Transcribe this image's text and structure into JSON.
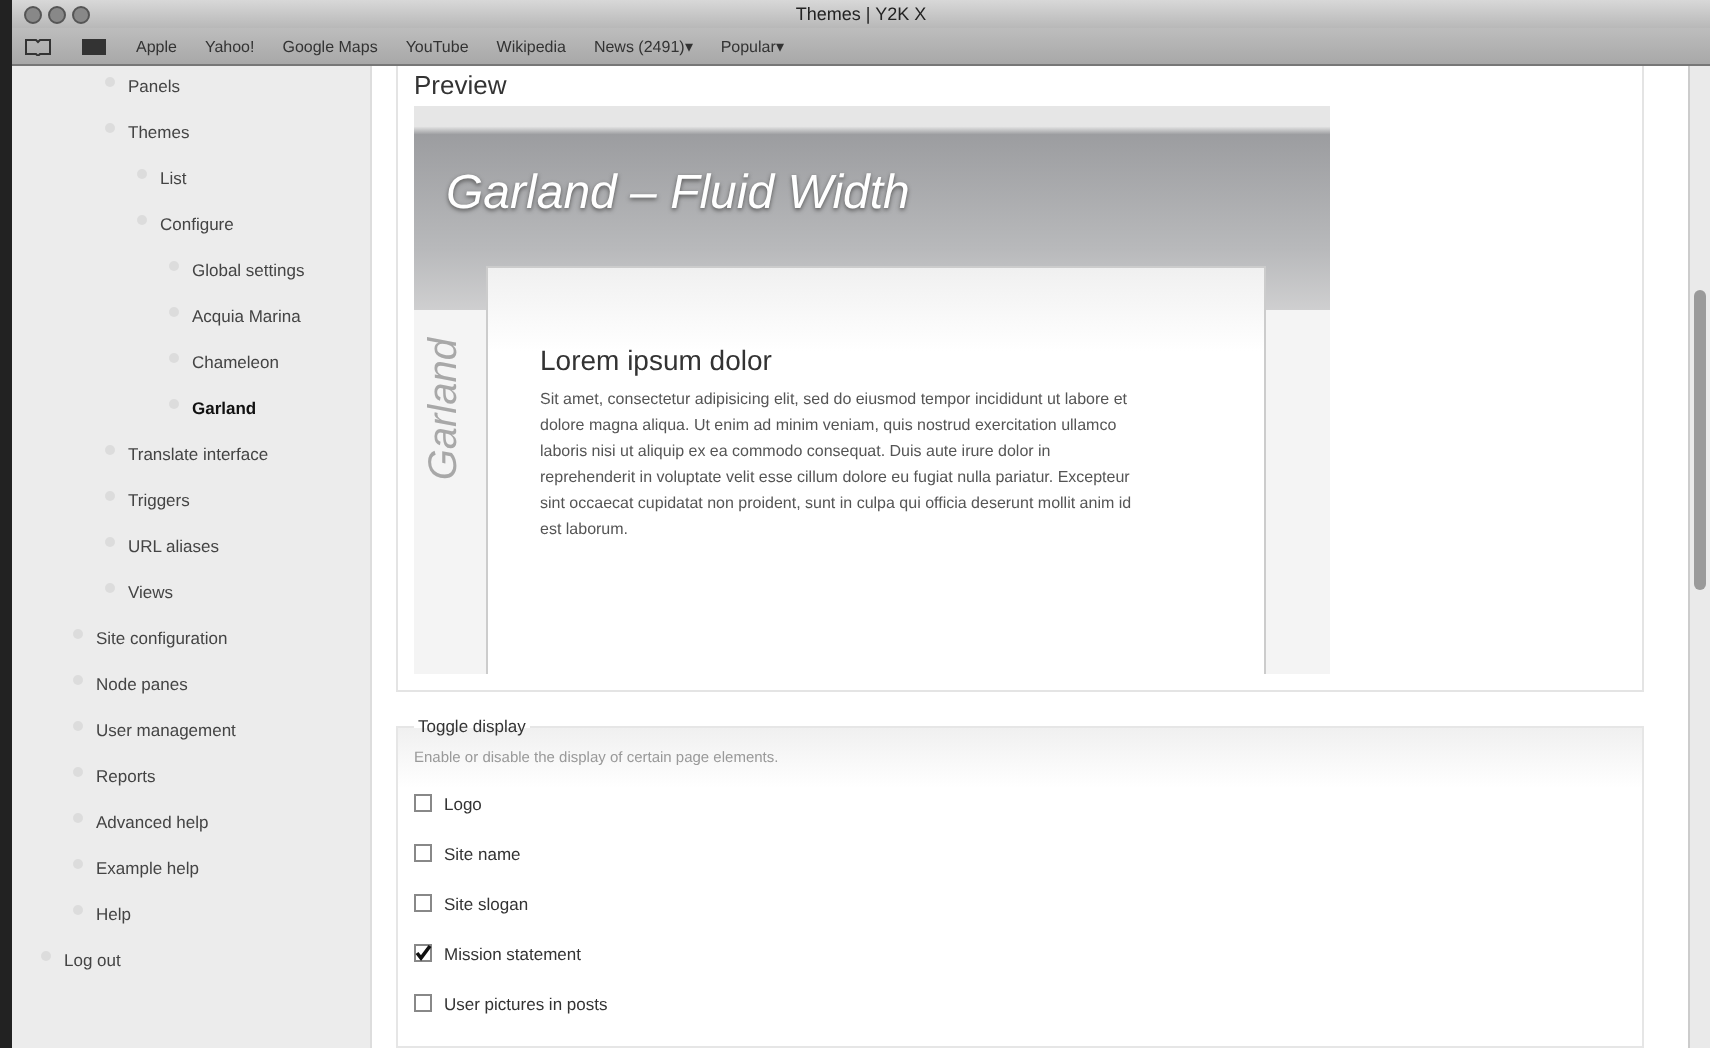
{
  "window": {
    "title": "Themes | Y2K X"
  },
  "bookmarks": [
    "Apple",
    "Yahoo!",
    "Google Maps",
    "YouTube",
    "Wikipedia",
    "News (2491)▾",
    "Popular▾"
  ],
  "menu": [
    {
      "children": [
        {
          "children": [
            {
              "label": "Panels",
              "selected": false
            },
            {
              "label": "Themes",
              "selected": false,
              "children": [
                {
                  "label": "List",
                  "selected": false
                },
                {
                  "label": "Configure",
                  "selected": false,
                  "children": [
                    {
                      "label": "Global settings",
                      "selected": false
                    },
                    {
                      "label": "Acquia Marina",
                      "selected": false
                    },
                    {
                      "label": "Chameleon",
                      "selected": false
                    },
                    {
                      "label": "Garland",
                      "selected": true
                    }
                  ]
                }
              ]
            },
            {
              "label": "Translate interface",
              "selected": false
            },
            {
              "label": "Triggers",
              "selected": false
            },
            {
              "label": "URL aliases",
              "selected": false
            },
            {
              "label": "Views",
              "selected": false
            }
          ]
        },
        {
          "label": "Site configuration",
          "selected": false
        },
        {
          "label": "Node panes",
          "selected": false
        },
        {
          "label": "User management",
          "selected": false
        },
        {
          "label": "Reports",
          "selected": false
        },
        {
          "label": "Advanced help",
          "selected": false
        },
        {
          "label": "Example help",
          "selected": false
        },
        {
          "label": "Help",
          "selected": false
        }
      ]
    },
    {
      "label": "Log out",
      "selected": false
    }
  ],
  "preview": {
    "heading": "Preview",
    "banner_title": "Garland – Fluid Width",
    "side_label": "Garland",
    "card_title": "Lorem ipsum dolor",
    "card_text": "Sit amet, consectetur adipisicing elit, sed do eiusmod tempor incididunt ut labore et dolore magna aliqua. Ut enim ad minim veniam, quis nostrud exercitation ullamco laboris nisi ut aliquip ex ea commodo consequat. Duis aute irure dolor in reprehenderit in voluptate velit esse cillum dolore eu fugiat nulla pariatur. Excepteur sint occaecat cupidatat non proident, sunt in culpa qui officia deserunt mollit anim id est laborum."
  },
  "toggle_display": {
    "legend": "Toggle display",
    "description": "Enable or disable the display of certain page elements.",
    "options": [
      {
        "label": "Logo",
        "checked": false
      },
      {
        "label": "Site name",
        "checked": false
      },
      {
        "label": "Site slogan",
        "checked": false
      },
      {
        "label": "Mission statement",
        "checked": true
      },
      {
        "label": "User pictures in posts",
        "checked": false
      }
    ]
  }
}
